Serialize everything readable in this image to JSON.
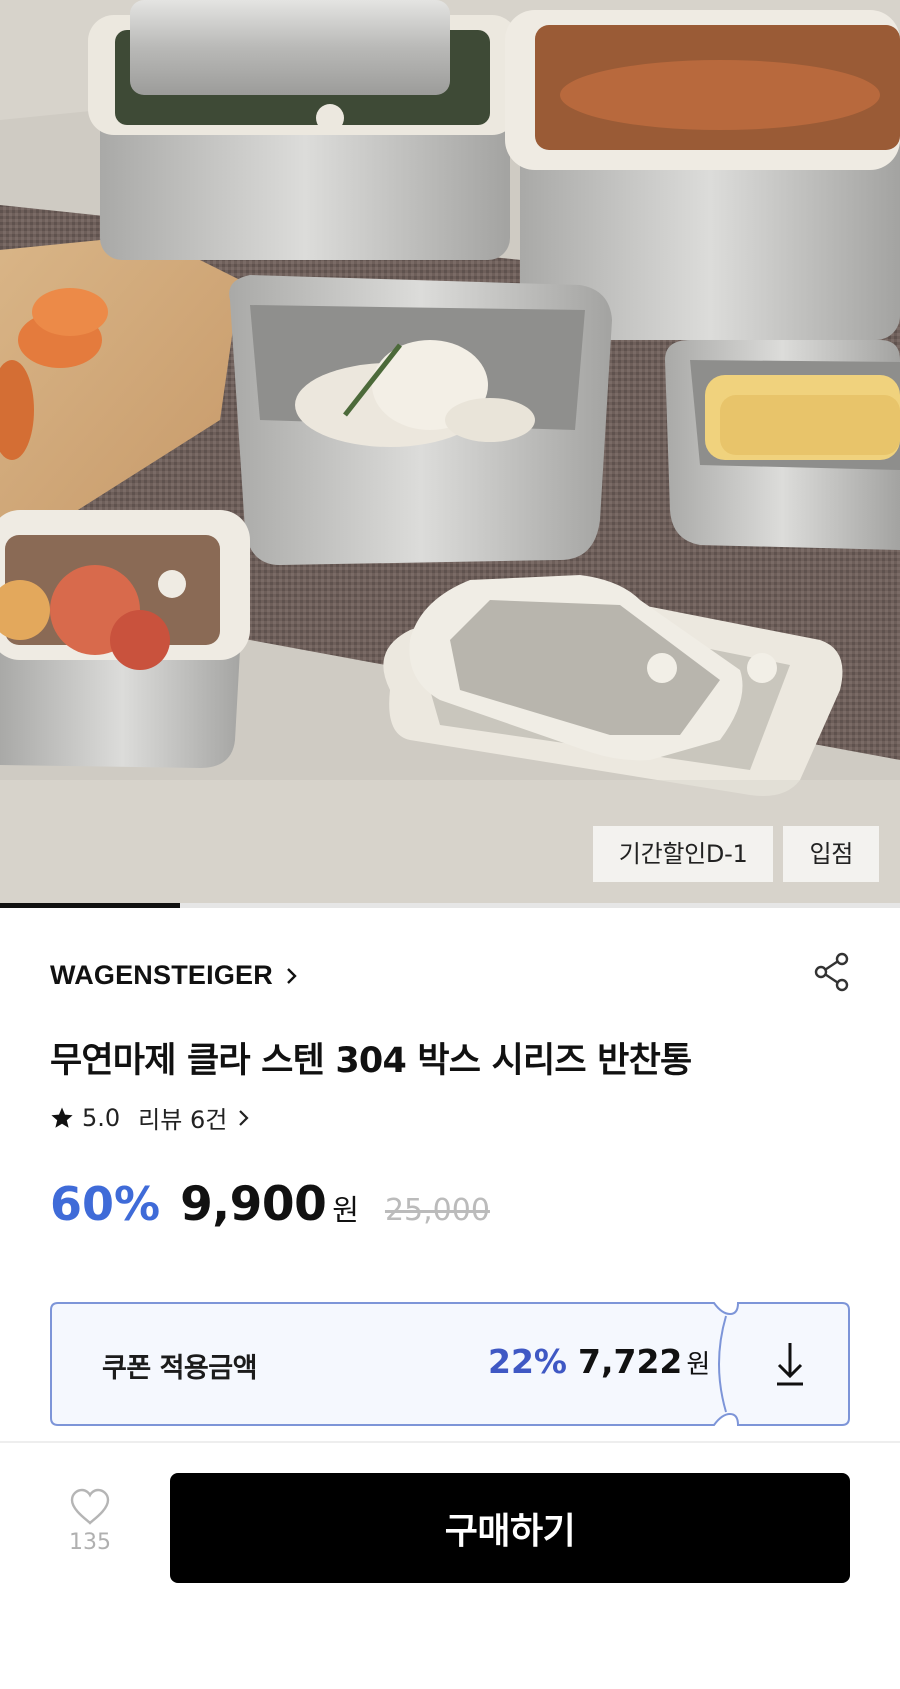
{
  "hero": {
    "image_description_icon": "product-photo",
    "badges": [
      "기간할인D-1",
      "입점"
    ],
    "gallery_progress": 0.2
  },
  "product": {
    "brand": "WAGENSTEIGER",
    "title": "무연마제 클라 스텐 304 박스 시리즈 반찬통",
    "rating": "5.0",
    "review_label": "리뷰 6건",
    "discount_rate": "60%",
    "sale_price": "9,900",
    "currency": "원",
    "original_price": "25,000"
  },
  "coupon": {
    "label": "쿠폰 적용금액",
    "rate": "22%",
    "price": "7,722",
    "currency": "원"
  },
  "bottom_bar": {
    "wish_count": "135",
    "buy_label": "구매하기"
  },
  "colors": {
    "accent_blue": "#3f6bd8",
    "coupon_border": "#7d95d8",
    "coupon_bg": "#f5f8fe",
    "buy_button": "#000000"
  }
}
